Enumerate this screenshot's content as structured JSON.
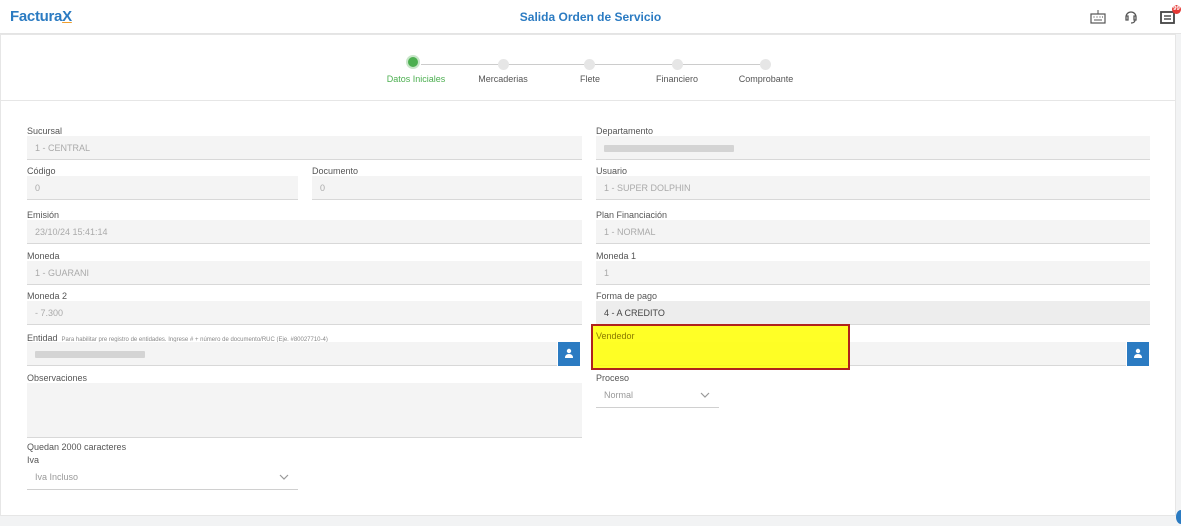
{
  "app": {
    "brand": "Factura",
    "brand_x": "X",
    "brand_suffix": ""
  },
  "header": {
    "title": "Salida Orden de Servicio",
    "notification_count": "99"
  },
  "icons": {
    "keyboard": "keyboard-icon",
    "support": "support-icon",
    "notifications": "notifications-icon",
    "user": "user-icon",
    "chevron": "chevron-down-icon"
  },
  "steps": [
    {
      "label": "Datos Iniciales",
      "active": true
    },
    {
      "label": "Mercaderias",
      "active": false
    },
    {
      "label": "Flete",
      "active": false
    },
    {
      "label": "Financiero",
      "active": false
    },
    {
      "label": "Comprobante",
      "active": false
    }
  ],
  "form": {
    "sucursal": {
      "label": "Sucursal",
      "value": "1 - CENTRAL"
    },
    "departamento": {
      "label": "Departamento",
      "value": ""
    },
    "codigo": {
      "label": "Código",
      "value": "0"
    },
    "documento": {
      "label": "Documento",
      "value": "0"
    },
    "usuario": {
      "label": "Usuario",
      "value": "1 - SUPER DOLPHIN"
    },
    "emision": {
      "label": "Emisión",
      "value": "23/10/24 15:41:14"
    },
    "plan": {
      "label": "Plan Financiación",
      "value": "1 - NORMAL"
    },
    "moneda": {
      "label": "Moneda",
      "value": "1 - GUARANI"
    },
    "moneda1": {
      "label": "Moneda 1",
      "value": "1"
    },
    "moneda2": {
      "label": "Moneda 2",
      "value": "- 7.300"
    },
    "forma_pago": {
      "label": "Forma de pago",
      "value": "4 - A CREDITO"
    },
    "entidad": {
      "label": "Entidad",
      "hint": "Para habilitar pre registro de entidades. Ingrese # + número de documento/RUC (Eje. #80027710-4)",
      "value": ""
    },
    "vendedor": {
      "label": "Vendedor",
      "value": ""
    },
    "observaciones": {
      "label": "Observaciones",
      "value": ""
    },
    "proceso": {
      "label": "Proceso",
      "value": "Normal"
    },
    "quedan": "Quedan 2000 caracteres",
    "iva": {
      "label": "Iva",
      "value": "Iva Incluso"
    }
  },
  "colors": {
    "accent": "#2b7bc2",
    "active_step": "#4caf50",
    "highlight": "#ffff00",
    "highlight_border": "#b0221d"
  }
}
